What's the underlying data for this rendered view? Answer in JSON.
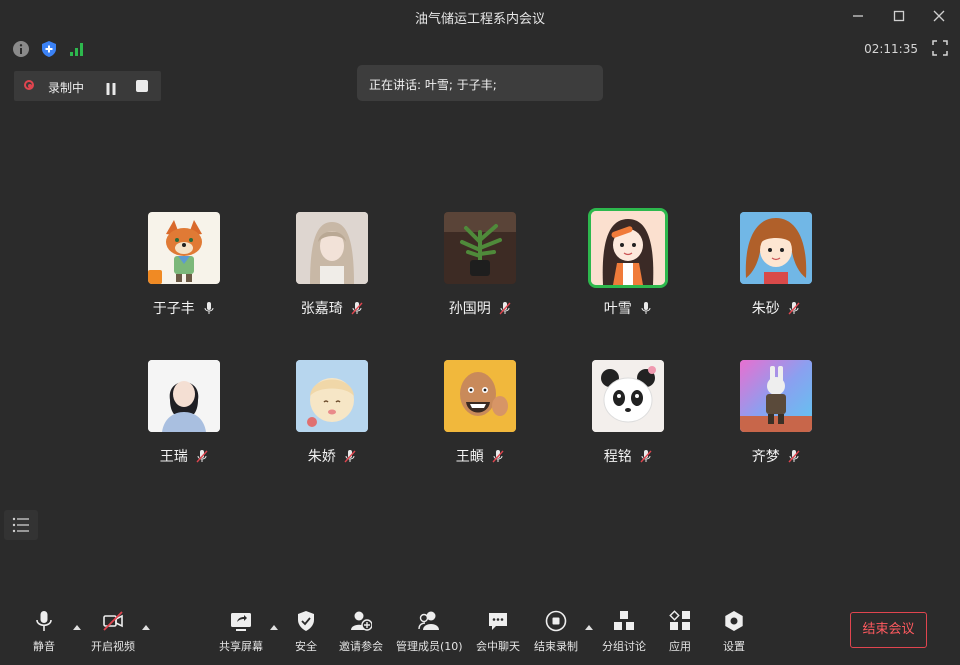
{
  "window": {
    "title": "油气储运工程系内会议",
    "controls": [
      "minimize-icon",
      "maximize-icon",
      "close-icon"
    ]
  },
  "status": {
    "clock": "02:11:35",
    "icons": [
      "info-icon",
      "shield-icon",
      "signal-icon",
      "fullscreen-icon"
    ]
  },
  "recording": {
    "label": "录制中",
    "status_color": "#e0454f"
  },
  "speaking": {
    "text": "正在讲话: 叶雪; 于子丰;"
  },
  "participants": [
    {
      "name": "于子丰",
      "mic": "on",
      "avatar": "fox-avatar",
      "badge": "host"
    },
    {
      "name": "张嘉琦",
      "mic": "muted",
      "avatar": "girl-photo-avatar"
    },
    {
      "name": "孙国明",
      "mic": "muted",
      "avatar": "plant-avatar"
    },
    {
      "name": "叶雪",
      "mic": "on",
      "avatar": "cartoon-girl-avatar",
      "active": true
    },
    {
      "name": "朱砂",
      "mic": "muted",
      "avatar": "cartoon-hair-avatar"
    },
    {
      "name": "王瑞",
      "mic": "muted",
      "avatar": "portrait-avatar"
    },
    {
      "name": "朱娇",
      "mic": "muted",
      "avatar": "anime-avatar"
    },
    {
      "name": "王頔",
      "mic": "muted",
      "avatar": "bald-man-avatar"
    },
    {
      "name": "程铭",
      "mic": "muted",
      "avatar": "panda-avatar"
    },
    {
      "name": "齐梦",
      "mic": "muted",
      "avatar": "rabbit-soldier-avatar"
    }
  ],
  "toolbar": {
    "mute": "静音",
    "video": "开启视频",
    "share": "共享屏幕",
    "security": "安全",
    "invite": "邀请参会",
    "manage": "管理成员(10)",
    "chat": "会中聊天",
    "end_record": "结束录制",
    "breakout": "分组讨论",
    "apps": "应用",
    "settings": "设置",
    "end_meeting": "结束会议"
  },
  "colors": {
    "background": "#2b2b2b",
    "active_speaker": "#2db84d",
    "danger": "#e0454f",
    "badge": "#f08a24",
    "security_blue": "#3b82f6",
    "signal_green": "#2db84d"
  }
}
